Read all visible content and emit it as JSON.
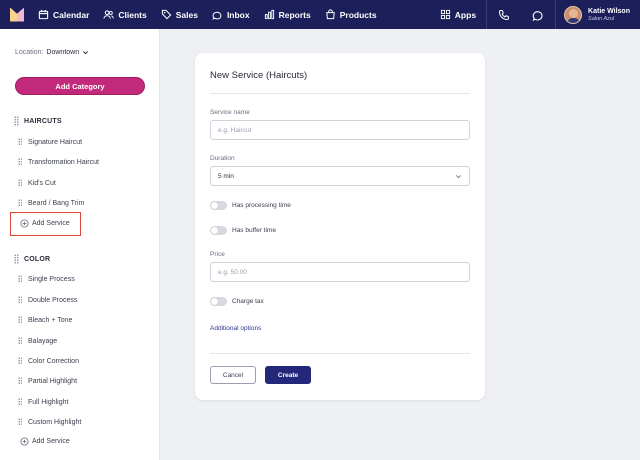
{
  "nav": {
    "items": [
      {
        "label": "Calendar",
        "icon": "calendar-icon"
      },
      {
        "label": "Clients",
        "icon": "clients-icon"
      },
      {
        "label": "Sales",
        "icon": "tag-icon"
      },
      {
        "label": "Inbox",
        "icon": "inbox-icon"
      },
      {
        "label": "Reports",
        "icon": "reports-icon"
      },
      {
        "label": "Products",
        "icon": "products-icon"
      }
    ],
    "apps_label": "Apps",
    "user_name": "Katie Wilson",
    "user_business": "Salon Azul"
  },
  "sidebar": {
    "location_label": "Location:",
    "location_value": "Downtown",
    "add_category_label": "Add Category",
    "categories": [
      {
        "title": "HAIRCUTS",
        "services": [
          "Signature Haircut",
          "Transformation Haircut",
          "Kid's Cut",
          "Beard / Bang Trim"
        ],
        "add_label": "Add Service"
      },
      {
        "title": "COLOR",
        "services": [
          "Single Process",
          "Double Process",
          "Bleach + Tone",
          "Balayage",
          "Color Correction",
          "Partial Highlight",
          "Full Highlight",
          "Custom Highlight"
        ],
        "add_label": "Add Service"
      }
    ]
  },
  "form": {
    "title": "New Service (Haircuts)",
    "service_name_label": "Service name",
    "service_name_placeholder": "e.g. Haircut",
    "duration_label": "Duration",
    "duration_value": "5 min",
    "processing_label": "Has processing time",
    "buffer_label": "Has buffer time",
    "price_label": "Price",
    "price_placeholder": "e.g. 50.00",
    "charge_tax_label": "Charge tax",
    "additional_options_label": "Additional options",
    "cancel_label": "Cancel",
    "create_label": "Create"
  },
  "colors": {
    "nav_bg": "#1c1f5a",
    "accent": "#c2297a",
    "primary_button": "#24287a",
    "highlight": "#e0463a"
  }
}
